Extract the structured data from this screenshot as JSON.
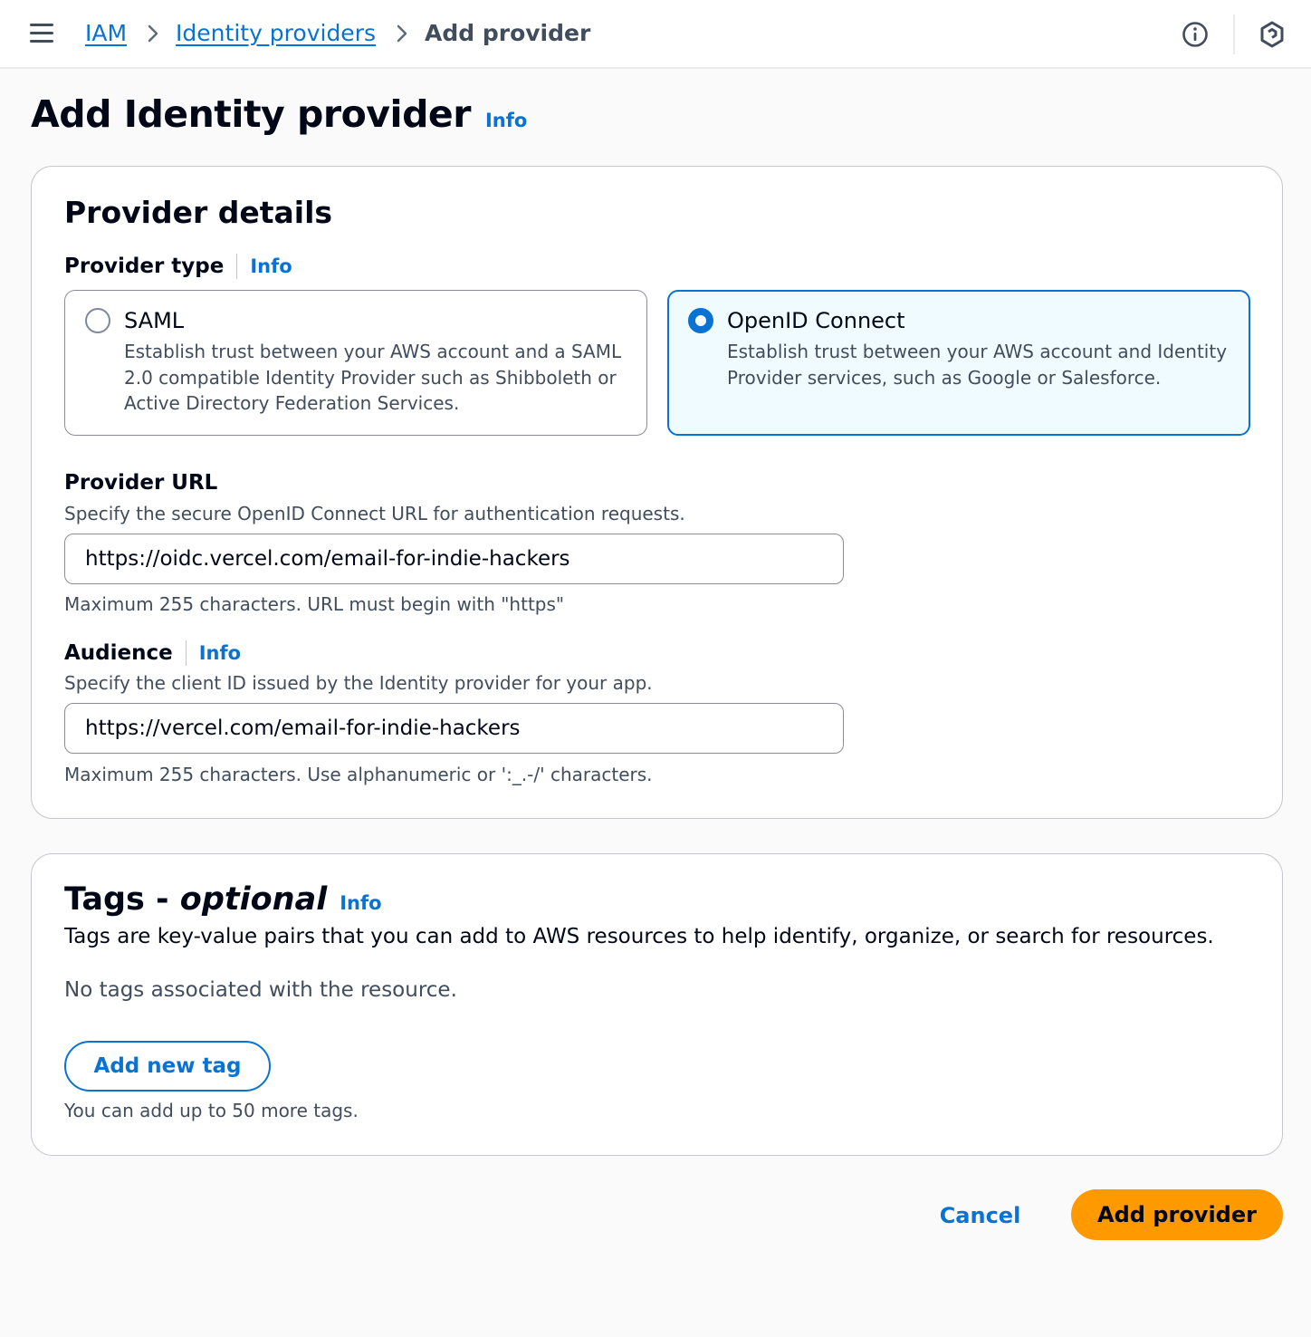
{
  "breadcrumb": {
    "items": [
      "IAM",
      "Identity providers"
    ],
    "current": "Add provider"
  },
  "page": {
    "title": "Add Identity provider",
    "info": "Info"
  },
  "provider_details": {
    "heading": "Provider details",
    "provider_type": {
      "label": "Provider type",
      "info": "Info",
      "options": [
        {
          "title": "SAML",
          "description": "Establish trust between your AWS account and a SAML 2.0 compatible Identity Provider such as Shibboleth or Active Directory Federation Services.",
          "selected": false
        },
        {
          "title": "OpenID Connect",
          "description": "Establish trust between your AWS account and Identity Provider services, such as Google or Salesforce.",
          "selected": true
        }
      ]
    },
    "provider_url": {
      "label": "Provider URL",
      "description": "Specify the secure OpenID Connect URL for authentication requests.",
      "value": "https://oidc.vercel.com/email-for-indie-hackers",
      "hint": "Maximum 255 characters. URL must begin with \"https\""
    },
    "audience": {
      "label": "Audience",
      "info": "Info",
      "description": "Specify the client ID issued by the Identity provider for your app.",
      "value": "https://vercel.com/email-for-indie-hackers",
      "hint": "Maximum 255 characters. Use alphanumeric or ':_.-/' characters."
    }
  },
  "tags": {
    "heading": "Tags -",
    "heading_optional": "optional",
    "info": "Info",
    "description": "Tags are key-value pairs that you can add to AWS resources to help identify, organize, or search for resources.",
    "empty_text": "No tags associated with the resource.",
    "add_button": "Add new tag",
    "limit_text": "You can add up to 50 more tags."
  },
  "actions": {
    "cancel": "Cancel",
    "submit": "Add provider"
  },
  "colors": {
    "link": "#0972d3",
    "primary": "#ff9900",
    "selected_tile_bg": "#f0fbff"
  },
  "icons": [
    "menu-icon",
    "chevron-right-icon",
    "info-icon",
    "settings-hexagon-icon"
  ]
}
